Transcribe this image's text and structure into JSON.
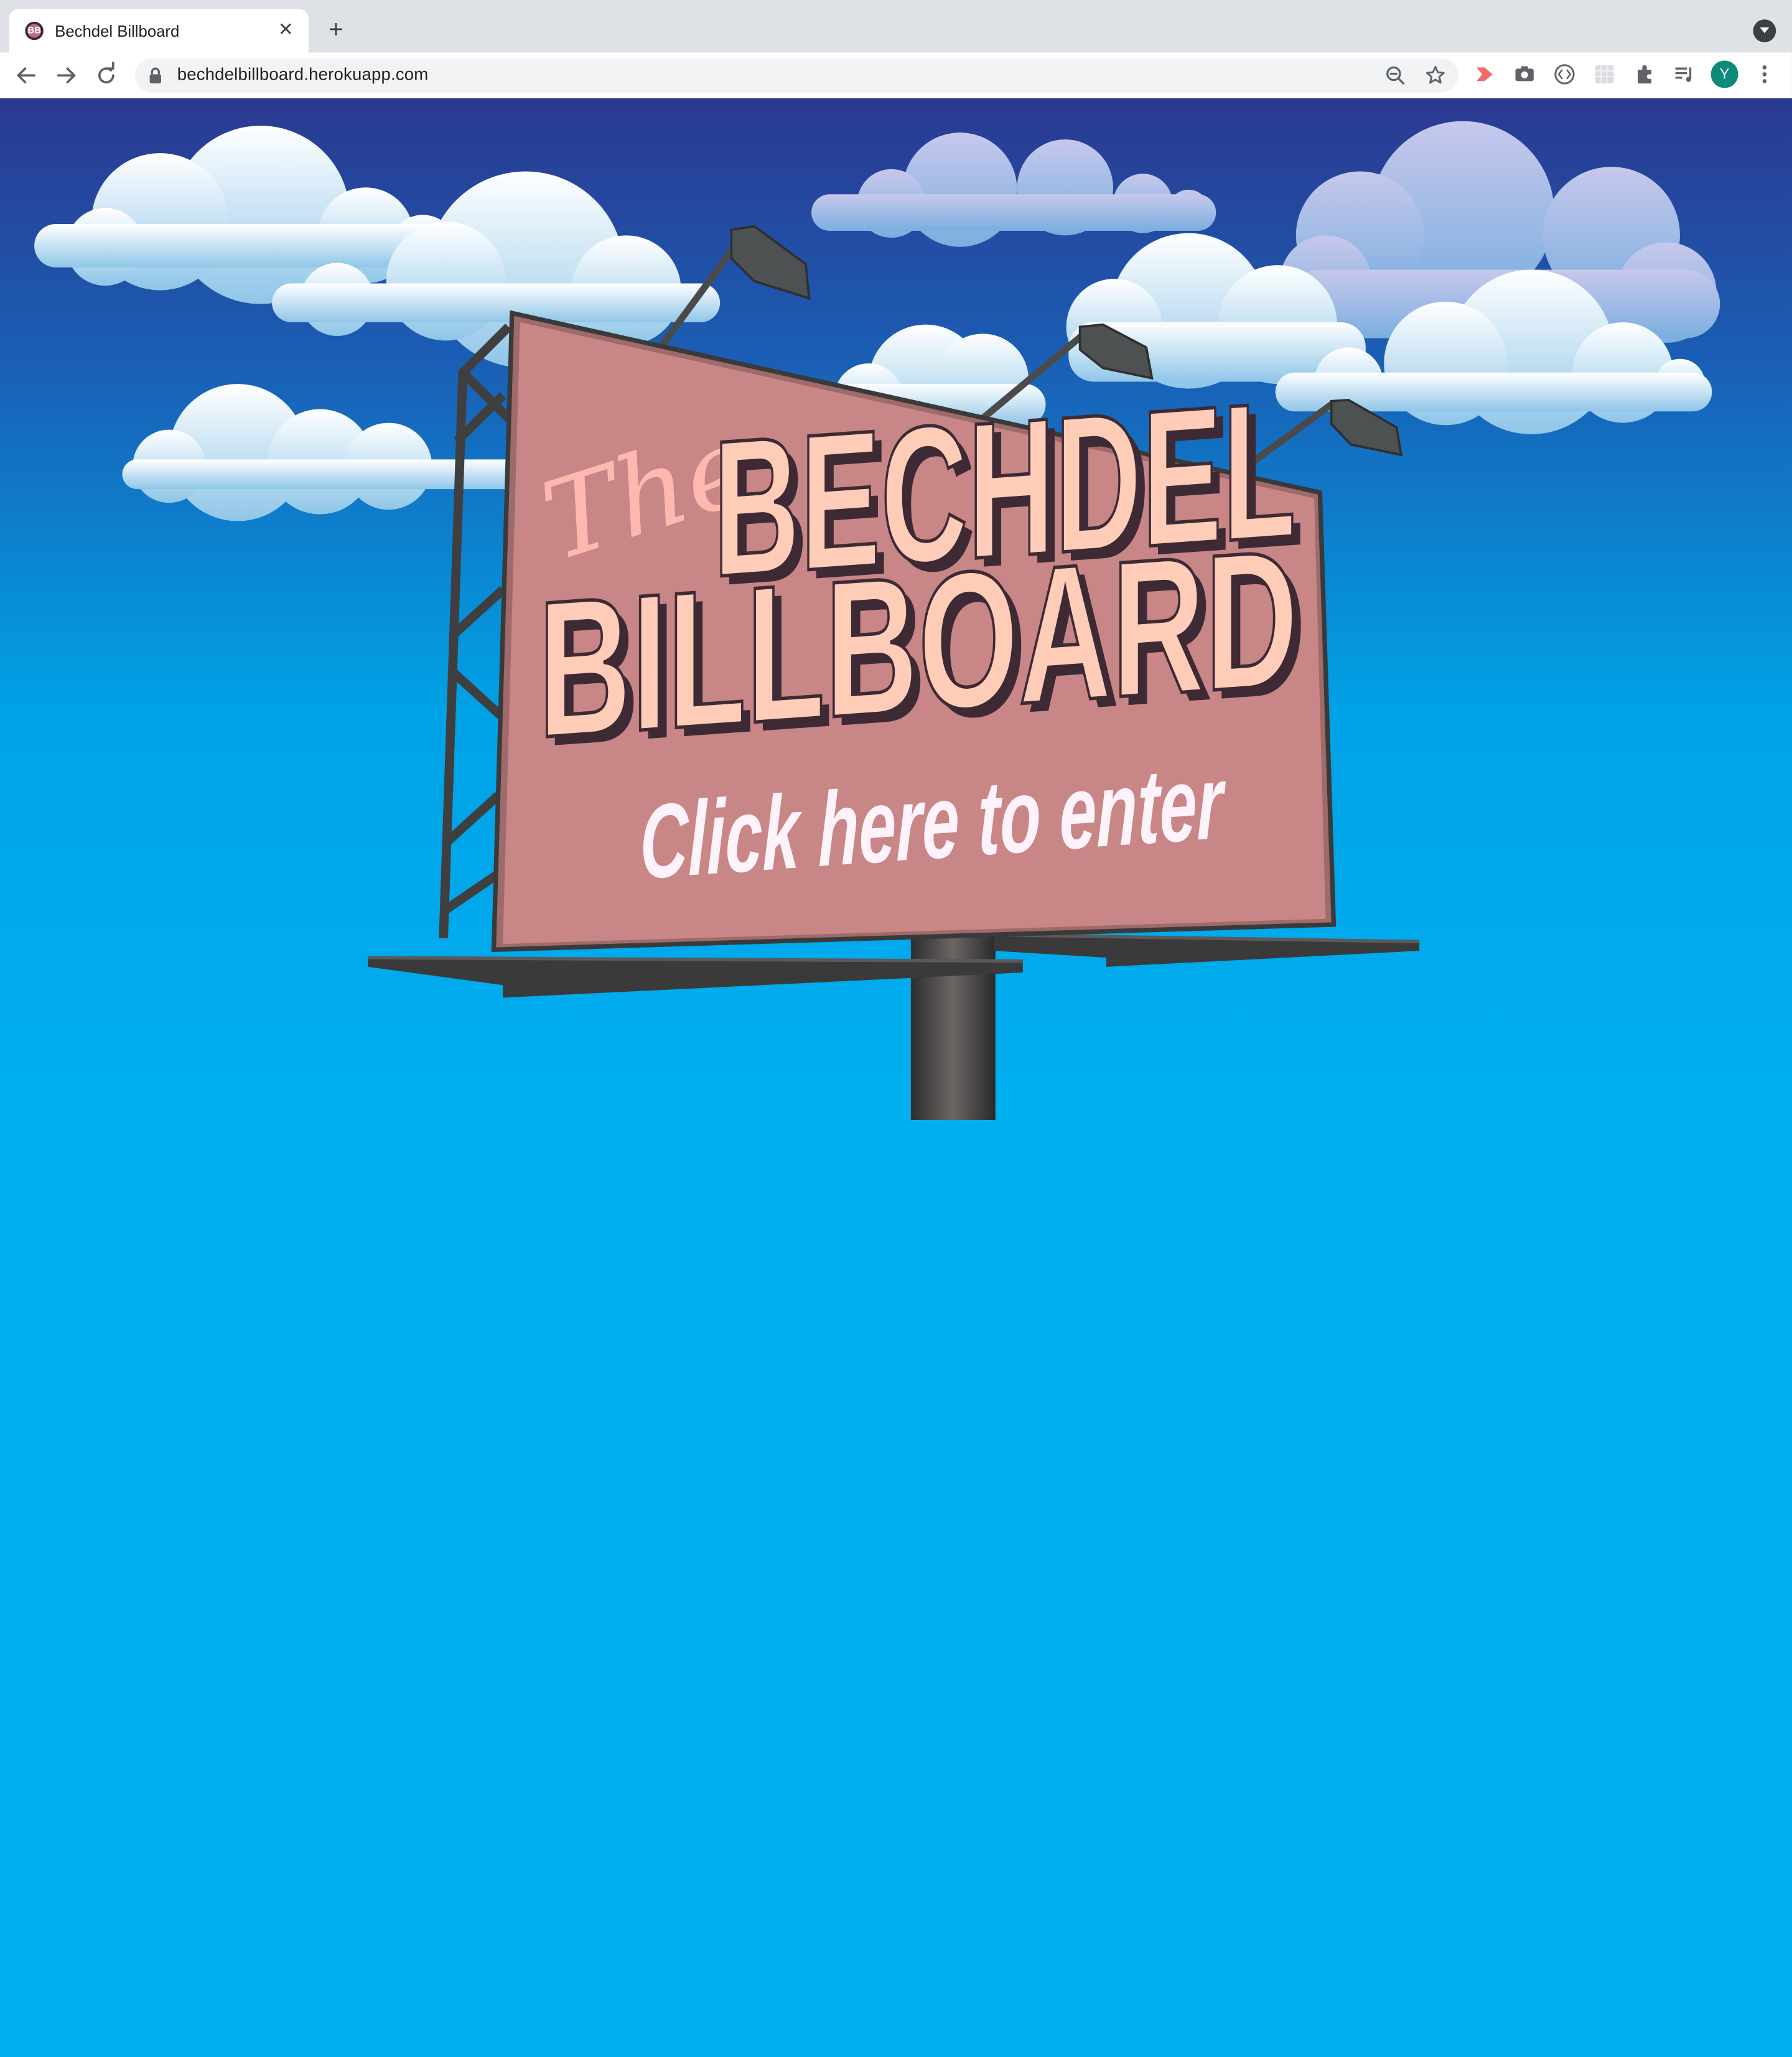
{
  "browser": {
    "tab": {
      "title": "Bechdel Billboard",
      "favicon_text": "BB"
    },
    "url": "bechdelbillboard.herokuapp.com",
    "avatar_letter": "Y"
  },
  "billboard": {
    "line_the": "The",
    "line_bechdel": "BECHDEL",
    "line_billboard": "BILLBOARD",
    "cta": "Click here to enter"
  },
  "colors": {
    "sky_top": "#2b3990",
    "sky_bottom": "#00aeef",
    "board": "#c98686",
    "letters": "#ffccb8",
    "cta": "#fff3fb"
  }
}
